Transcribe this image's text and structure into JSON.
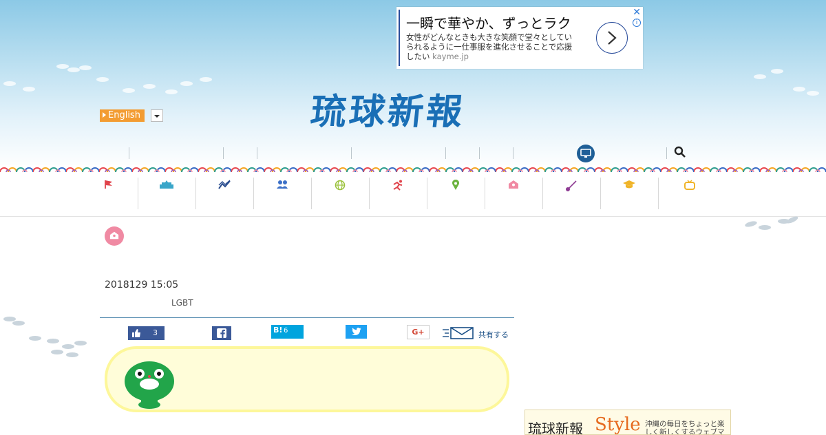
{
  "ad": {
    "title": "一瞬で華やか、ずっとラク",
    "body": "女性がどんなときも大きな笑顔で堂々としていられるように一仕事服を進化させることで応援したい",
    "domain": "kayme.jp",
    "close_glyph": "✕",
    "info_glyph": "i"
  },
  "header": {
    "logo": "琉球新報",
    "language_button": "English"
  },
  "category_nav": {
    "icons": [
      "flag-icon",
      "parliament-icon",
      "chart-icon",
      "people-icon",
      "globe-icon",
      "runner-icon",
      "pin-icon",
      "house-icon",
      "sanshin-icon",
      "graduation-cap-icon",
      "tv-icon"
    ],
    "colors": [
      "#e0444c",
      "#3aa6c9",
      "#2a4d8f",
      "#3b6fc7",
      "#9bc23c",
      "#e0444c",
      "#6cb33f",
      "#f08aa3",
      "#8e3b93",
      "#f0b429",
      "#f0b429"
    ]
  },
  "article": {
    "date": "2018129 15:05",
    "tag": "LGBT"
  },
  "share": {
    "like_count": "3",
    "hatena_label": "B!",
    "hatena_count": "6",
    "gplus_label": "G+",
    "mail_label": "共有する"
  },
  "banner": {
    "brand": "琉球新報",
    "style": "Style",
    "tagline": "沖縄の毎日をちょっと楽しく新しくするウェブマガジン"
  },
  "colors": {
    "brand_blue": "#1a6fb6",
    "nav_dark": "#1f5f97",
    "facebook": "#3b5998",
    "hatena": "#00a4de",
    "twitter": "#1da1f2",
    "english_button": "#f39c32"
  }
}
